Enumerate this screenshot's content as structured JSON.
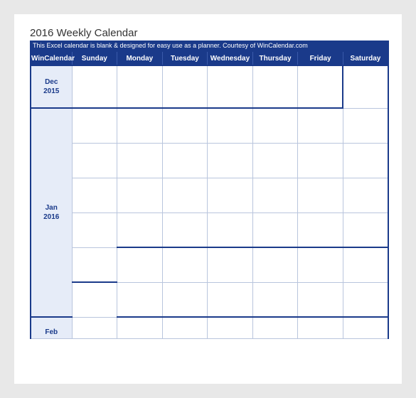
{
  "title": "2016 Weekly Calendar",
  "subtitle": "This Excel calendar is blank & designed for easy use as a planner.  Courtesy of WinCalendar.com",
  "brand": "WinCalendar",
  "days": [
    "Sunday",
    "Monday",
    "Tuesday",
    "Wednesday",
    "Thursday",
    "Friday",
    "Saturday"
  ],
  "months": {
    "dec": "Dec\n2015",
    "jan": "Jan\n2016",
    "feb": "Feb"
  }
}
